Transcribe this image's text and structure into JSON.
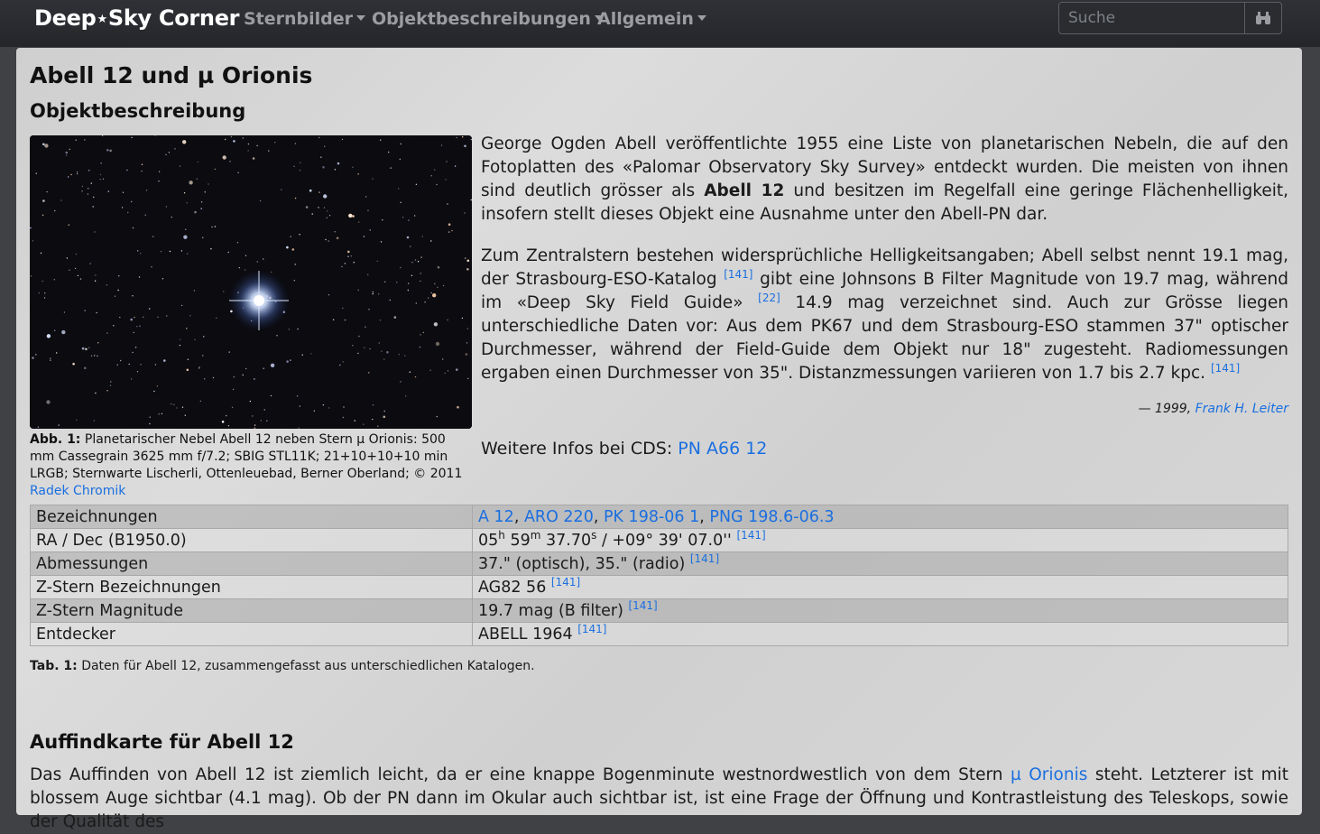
{
  "nav": {
    "brand_left": "Deep",
    "brand_star": "★",
    "brand_right": "Sky Corner",
    "menu": [
      "Sternbilder",
      "Objektbeschreibungen",
      "Allgemein"
    ],
    "search_placeholder": "Suche"
  },
  "page": {
    "title": "Abell 12 und µ Orionis",
    "section1": "Objektbeschreibung",
    "figure": {
      "label": "Abb. 1:",
      "text": " Planetarischer Nebel Abell 12 neben Stern µ Orionis: 500 mm Cassegrain 3625 mm f/7.2; SBIG STL11K; 21+10+10+10 min LRGB; Sternwarte Lischerli, Ottenleuebad, Berner Oberland; © 2011 ",
      "author": "Radek Chromik"
    },
    "para1": {
      "a": "George Ogden Abell veröffentlichte 1955 eine Liste von planetarischen Nebeln, die auf den Fotoplatten des «Palomar Observatory Sky Survey» entdeckt wurden. Die meisten von ihnen sind deutlich grösser als ",
      "bold": "Abell 12",
      "b": " und besitzen im Regelfall eine geringe Flächenhelligkeit, insofern stellt dieses Objekt eine Ausnahme unter den Abell-PN dar."
    },
    "para2": {
      "a": "Zum Zentralstern bestehen widersprüchliche Helligkeitsangaben; Abell selbst nennt 19.1 mag, der Strasbourg-ESO-Katalog ",
      "ref1": "[141]",
      "b": " gibt eine Johnsons B Filter Magnitude von 19.7 mag, während im «Deep Sky Field Guide» ",
      "ref2": "[22]",
      "c": " 14.9 mag verzeichnet sind. Auch zur Grösse liegen unterschiedliche Daten vor: Aus dem PK67 und dem Strasbourg-ESO stammen 37\" optischer Durchmesser, während der Field-Guide dem Objekt nur 18\" zugesteht. Radiomessungen ergaben einen Durchmesser von 35\". Distanzmessungen variieren von 1.7 bis 2.7 kpc. ",
      "ref3": "[141]"
    },
    "citation": {
      "prefix": "— 1999, ",
      "author": "Frank H. Leiter"
    },
    "cds": {
      "label": "Weitere Infos bei CDS: ",
      "link": "PN A66 12"
    },
    "table": {
      "rows": [
        {
          "label": "Bezeichnungen",
          "links": [
            "A 12",
            "ARO 220",
            "PK 198-06 1",
            "PNG 198.6-06.3"
          ]
        },
        {
          "label": "RA / Dec (B1950.0)",
          "ra_h": "05",
          "ra_h_unit": "h",
          "ra_m": " 59",
          "ra_m_unit": "m",
          "ra_s": " 37.70",
          "ra_s_unit": "s",
          "dec": " / +09° 39' 07.0'' ",
          "ref": "[141]"
        },
        {
          "label": "Abmessungen",
          "value": "37.\" (optisch), 35.\" (radio) ",
          "ref": "[141]"
        },
        {
          "label": "Z-Stern Bezeichnungen",
          "value": "AG82 56 ",
          "ref": "[141]"
        },
        {
          "label": "Z-Stern Magnitude",
          "value": "19.7 mag (B filter) ",
          "ref": "[141]"
        },
        {
          "label": "Entdecker",
          "value": "ABELL 1964 ",
          "ref": "[141]"
        }
      ],
      "caption_label": "Tab. 1:",
      "caption_text": " Daten für Abell 12, zusammengefasst aus unterschiedlichen Katalogen."
    },
    "section2": "Auffindkarte für Abell 12",
    "para3": {
      "a": "Das Auffinden von Abell 12 ist ziemlich leicht, da er eine knappe Bogenminute westnordwestlich von dem Stern ",
      "link": "µ Orionis",
      "b": " steht. Letzterer ist mit blossem Auge sichtbar (4.1 mag). Ob der PN dann im Okular auch sichtbar ist, ist eine Frage der Öffnung und Kontrastleistung des Teleskops, sowie der Qualität des"
    }
  },
  "colors": {
    "link": "#1a6fe0",
    "navbar": "#2b2d31"
  }
}
